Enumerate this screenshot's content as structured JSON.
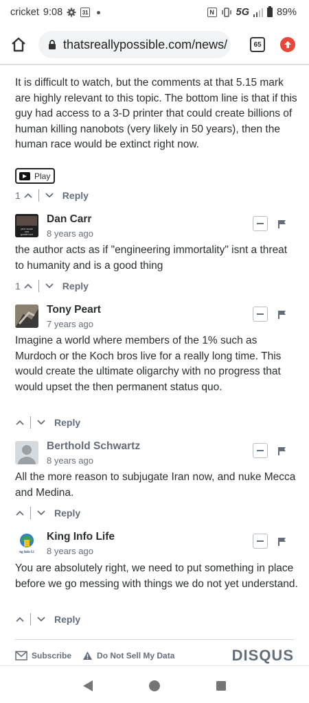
{
  "status_bar": {
    "carrier": "cricket",
    "time": "9:08",
    "calendar_day": "31",
    "network": "5G",
    "battery": "89%"
  },
  "browser": {
    "url": "thatsreallypossible.com/news/",
    "tab_count": "65"
  },
  "first_comment": {
    "text": "It is difficult to watch, but the comments at that 5.15 mark are highly relevant to this topic. The bottom line is that if this guy had access to a 3-D printer that could create billions of human killing nanobots (very likely in 50 years), then the human race would be extinct right now.",
    "play_label": "Play",
    "votes": "1",
    "reply_label": "Reply"
  },
  "comments": [
    {
      "author": "Dan Carr",
      "time": "8 years ago",
      "avatar_text": "prior would\nnow\ngoodie cool",
      "text": "the author acts as if \"engineering immortality\" isnt a threat to humanity and is a good thing",
      "votes": "1",
      "reply_label": "Reply"
    },
    {
      "author": "Tony Peart",
      "time": "7 years ago",
      "text": "Imagine a world where members of the 1% such as Murdoch or the Koch bros live for a really long time. This would create the ultimate oligarchy with no progress that would upset the then permanent status quo.",
      "votes": "",
      "reply_label": "Reply"
    },
    {
      "author": "Berthold Schwartz",
      "time": "8 years ago",
      "text": "All the more reason to subjugate Iran now, and nuke Mecca and Medina.",
      "votes": "",
      "reply_label": "Reply"
    },
    {
      "author": "King Info Life",
      "time": "8 years ago",
      "avatar_text": "ng Info Li",
      "text": "You are absolutely right, we need to put something in place before we go messing with things we do not yet understand.",
      "votes": "",
      "reply_label": "Reply"
    }
  ],
  "footer": {
    "subscribe_label": "Subscribe",
    "do_not_sell_label": "Do Not Sell My Data",
    "brand": "DISQUS"
  },
  "colors": {
    "accent_red": "#e8483b",
    "meta_gray": "#656c7a",
    "text_dark": "#2a2e2e"
  }
}
